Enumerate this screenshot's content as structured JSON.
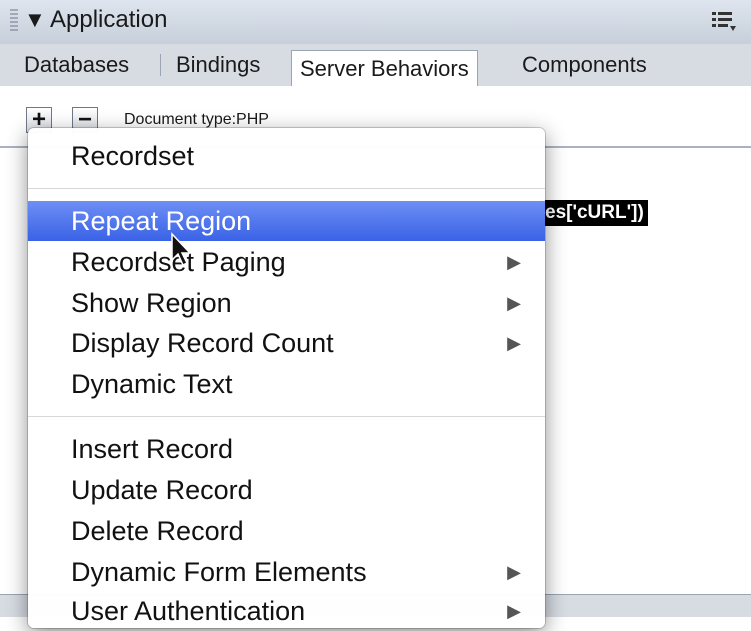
{
  "panel": {
    "title": "Application",
    "collapse_glyph": "▼",
    "options_icon": "panel-options-icon"
  },
  "tabs": [
    {
      "label": "Databases",
      "active": false
    },
    {
      "label": "Bindings",
      "active": false
    },
    {
      "label": "Server Behaviors",
      "active": true
    },
    {
      "label": "Components",
      "active": false
    }
  ],
  "toolbar": {
    "add_label": "+",
    "remove_label": "−",
    "document_type": "Document type:PHP"
  },
  "code_fragment": "es['cURL'])",
  "menu": {
    "items": [
      {
        "label": "Recordset",
        "submenu": false,
        "highlighted": false
      },
      {
        "label": "Repeat Region",
        "submenu": false,
        "highlighted": true
      },
      {
        "label": "Recordset Paging",
        "submenu": true,
        "highlighted": false
      },
      {
        "label": "Show Region",
        "submenu": true,
        "highlighted": false
      },
      {
        "label": "Display Record Count",
        "submenu": true,
        "highlighted": false
      },
      {
        "label": "Dynamic Text",
        "submenu": false,
        "highlighted": false
      },
      {
        "label": "Insert Record",
        "submenu": false,
        "highlighted": false
      },
      {
        "label": "Update Record",
        "submenu": false,
        "highlighted": false
      },
      {
        "label": "Delete Record",
        "submenu": false,
        "highlighted": false
      },
      {
        "label": "Dynamic Form Elements",
        "submenu": true,
        "highlighted": false
      },
      {
        "label": "User Authentication",
        "submenu": true,
        "highlighted": false
      }
    ],
    "submenu_arrow": "▶"
  },
  "colors": {
    "highlight": "#3a62e6",
    "titlebar": "#c6cfdb"
  }
}
